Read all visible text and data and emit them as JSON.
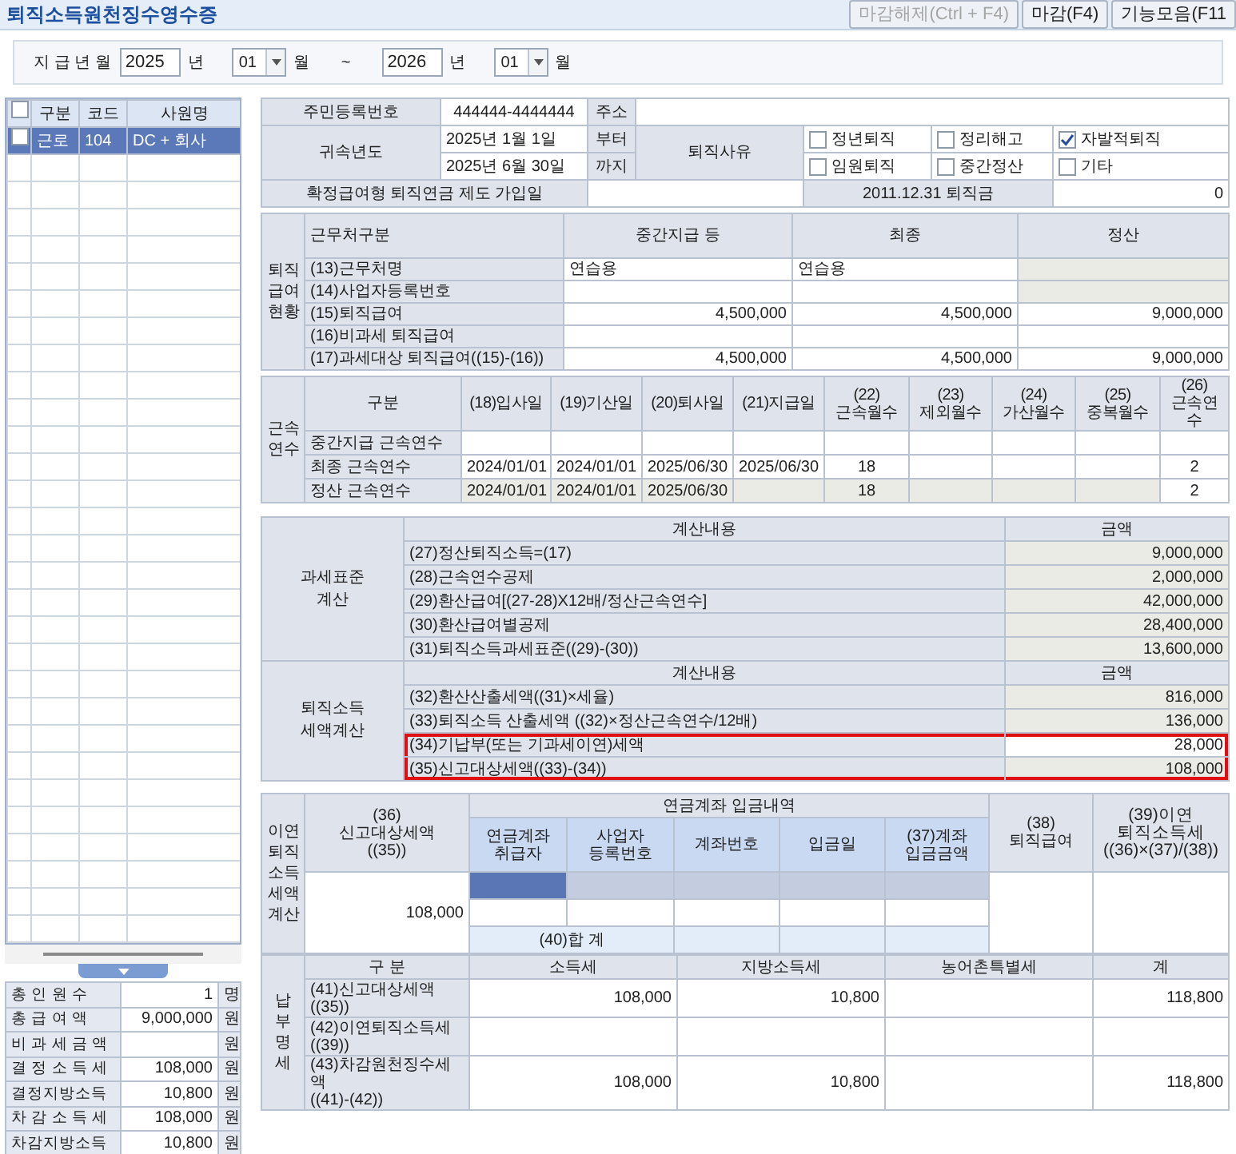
{
  "title": "퇴직소득원천징수영수증",
  "toolbar_buttons": [
    {
      "label": "마감해제(Ctrl + F4)",
      "disabled": true
    },
    {
      "label": "마감(F4)",
      "disabled": false
    },
    {
      "label": "기능모음(F11",
      "disabled": false
    }
  ],
  "period": {
    "label": "지 급 년 월",
    "from_year": "2025",
    "from_year_unit": "년",
    "from_month": "01",
    "from_month_unit": "월",
    "separator": "~",
    "to_year": "2026",
    "to_year_unit": "년",
    "to_month": "01",
    "to_month_unit": "월"
  },
  "employee_list": {
    "all_checked": false,
    "columns": [
      "구분",
      "코드",
      "사원명"
    ],
    "rows": [
      {
        "checked": false,
        "selected": true,
        "cells": [
          "근로",
          "104",
          "DC + 회사"
        ]
      }
    ]
  },
  "totals": [
    {
      "label": "총 인 원 수",
      "value": "1",
      "unit": "명"
    },
    {
      "label": "총 급 여 액",
      "value": "9,000,000",
      "unit": "원"
    },
    {
      "label": "비 과 세 금 액",
      "unit": "원"
    },
    {
      "label": "결 정 소 득 세",
      "value": "108,000",
      "unit": "원"
    },
    {
      "label": "결정지방소득",
      "value": "10,800",
      "unit": "원"
    },
    {
      "label": "차 감 소 득 세",
      "value": "108,000",
      "unit": "원"
    },
    {
      "label": "차감지방소득",
      "value": "10,800",
      "unit": "원"
    }
  ],
  "basic_info": {
    "resident_number_label": "주민등록번호",
    "resident_number": "444444-4444444",
    "address_label": "주소",
    "year_label": "귀속년도",
    "start_date": "2025년 1월 1일",
    "start_suffix": "부터",
    "end_date": "2025년 6월 30일",
    "end_suffix": "까지",
    "reason_label": "퇴직사유",
    "reasons": [
      {
        "label": "정년퇴직",
        "checked": false
      },
      {
        "label": "정리해고",
        "checked": false
      },
      {
        "label": "자발적퇴직",
        "checked": true
      },
      {
        "label": "임원퇴직",
        "checked": false
      },
      {
        "label": "중간정산",
        "checked": false
      },
      {
        "label": "기타",
        "checked": false
      }
    ],
    "pension_join_label": "확정급여형 퇴직연금 제도 가입일",
    "severance_label": "2011.12.31 퇴직금",
    "severance": "0"
  },
  "benefits": {
    "side_label": "퇴직급여현황",
    "label_header": "근무처구분",
    "columns": [
      "중간지급 등",
      "최종",
      "정산"
    ],
    "rows": [
      {
        "label": "(13)근무처명",
        "cells": [
          {
            "text": "연습용",
            "editable": true
          },
          {
            "text": "연습용",
            "editable": true
          },
          {
            "editable": false
          }
        ]
      },
      {
        "label": "(14)사업자등록번호",
        "cells": [
          {
            "editable": true
          },
          {
            "editable": true
          },
          {
            "editable": false
          }
        ]
      },
      {
        "label": "(15)퇴직급여",
        "cells": [
          {
            "text": "4,500,000",
            "editable": true
          },
          {
            "text": "4,500,000",
            "editable": true
          },
          {
            "text": "9,000,000",
            "editable": true
          }
        ]
      },
      {
        "label": "(16)비과세 퇴직급여",
        "cells": [
          {
            "editable": true
          },
          {
            "editable": true
          },
          {
            "editable": true
          }
        ]
      },
      {
        "label": "(17)과세대상 퇴직급여((15)-(16))",
        "cells": [
          {
            "text": "4,500,000",
            "editable": true
          },
          {
            "text": "4,500,000",
            "editable": true
          },
          {
            "text": "9,000,000",
            "editable": true
          }
        ]
      }
    ]
  },
  "service": {
    "side_label": "근속연수",
    "label_header": "구분",
    "columns": [
      "(18)입사일",
      "(19)기산일",
      "(20)퇴사일",
      "(21)지급일",
      "(22)\n근속월수",
      "(23)\n제외월수",
      "(24)\n가산월수",
      "(25)\n중복월수",
      "(26)\n근속연수"
    ],
    "rows": [
      {
        "label": "중간지급 근속연수",
        "cells": [
          {
            "editable": true
          },
          {
            "editable": true
          },
          {
            "editable": true
          },
          {
            "editable": true
          },
          {
            "editable": true
          },
          {
            "editable": true
          },
          {
            "editable": true
          },
          {
            "editable": true
          },
          {
            "editable": true
          }
        ]
      },
      {
        "label": "최종 근속연수",
        "cells": [
          {
            "text": "2024/01/01",
            "editable": true
          },
          {
            "text": "2024/01/01",
            "editable": true
          },
          {
            "text": "2025/06/30",
            "editable": true
          },
          {
            "text": "2025/06/30",
            "editable": true
          },
          {
            "text": "18",
            "editable": true
          },
          {
            "editable": true
          },
          {
            "editable": true
          },
          {
            "editable": true
          },
          {
            "text": "2",
            "editable": true
          }
        ]
      },
      {
        "label": "정산 근속연수",
        "cells": [
          {
            "text": "2024/01/01",
            "editable": false
          },
          {
            "text": "2024/01/01",
            "editable": false
          },
          {
            "text": "2025/06/30",
            "editable": false
          },
          {
            "editable": false
          },
          {
            "text": "18",
            "editable": false
          },
          {
            "editable": false
          },
          {
            "editable": false
          },
          {
            "editable": false
          },
          {
            "text": "2",
            "editable": true
          }
        ]
      }
    ]
  },
  "tax_calc": {
    "groups": [
      {
        "label": "과세표준\n계산",
        "content_header": "계산내용",
        "amount_header": "금액",
        "rows": [
          {
            "label": "(27)정산퇴직소득=(17)",
            "amount": "9,000,000",
            "editable": false,
            "highlighted": false
          },
          {
            "label": "(28)근속연수공제",
            "amount": "2,000,000",
            "editable": false,
            "highlighted": false
          },
          {
            "label": "(29)환산급여[(27-28)X12배/정산근속연수]",
            "amount": "42,000,000",
            "editable": false,
            "highlighted": false
          },
          {
            "label": "(30)환산급여별공제",
            "amount": "28,400,000",
            "editable": false,
            "highlighted": false
          },
          {
            "label": "(31)퇴직소득과세표준((29)-(30))",
            "amount": "13,600,000",
            "editable": false,
            "highlighted": false
          }
        ]
      },
      {
        "label": "퇴직소득\n세액계산",
        "content_header": "계산내용",
        "amount_header": "금액",
        "rows": [
          {
            "label": "(32)환산산출세액((31)×세율)",
            "amount": "816,000",
            "editable": false,
            "highlighted": false
          },
          {
            "label": "(33)퇴직소득 산출세액 ((32)×정산근속연수/12배)",
            "amount": "136,000",
            "editable": false,
            "highlighted": false
          },
          {
            "label": "(34)기납부(또는 기과세이연)세액",
            "amount": "28,000",
            "editable": true,
            "highlighted": true
          },
          {
            "label": "(35)신고대상세액((33)-(34))",
            "amount": "108,000",
            "editable": false,
            "highlighted": true
          }
        ]
      }
    ]
  },
  "deferral": {
    "side_label": "이연퇴직소득세액계산",
    "reported_tax_header": "(36)\n신고대상세액\n((35))",
    "deposit_group": "연금계좌 입금내역",
    "deposit_columns": [
      "연금계좌\n취급자",
      "사업자\n등록번호",
      "계좌번호",
      "입금일",
      "(37)계좌\n입금금액"
    ],
    "benefit_header": "(38)\n퇴직급여",
    "deferred_tax_header": "(39)이연\n퇴직소득세\n((36)×(37)/(38))",
    "reported_tax": "108,000",
    "deposit_rows": [
      {
        "selected": true
      },
      {
        "selected": false
      }
    ],
    "total_label": "(40)합 계"
  },
  "payment": {
    "side_label": "납부명세",
    "columns": [
      "구 분",
      "소득세",
      "지방소득세",
      "농어촌특별세",
      "계"
    ],
    "rows": [
      {
        "label": "(41)신고대상세액\n((35))",
        "income_tax": "108,000",
        "local_tax": "10,800",
        "total": "118,800"
      },
      {
        "label": "(42)이연퇴직소득세\n((39))"
      },
      {
        "label": "(43)차감원천징수세액\n((41)-(42))",
        "income_tax": "108,000",
        "local_tax": "10,800",
        "total": "118,800"
      }
    ]
  }
}
